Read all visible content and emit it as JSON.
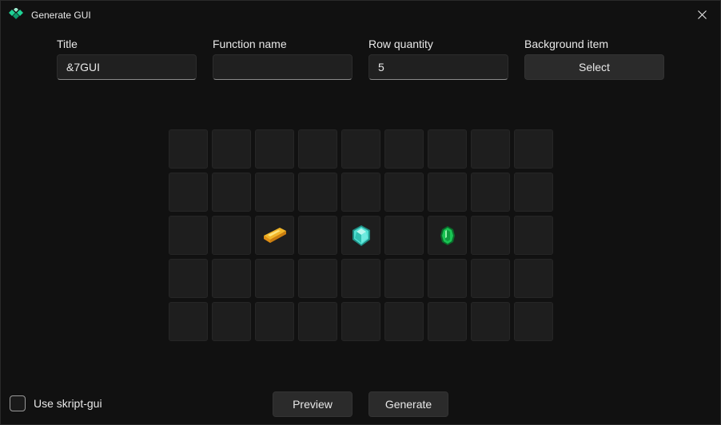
{
  "window": {
    "title": "Generate GUI",
    "app_icon": "diamond-cluster-icon",
    "accent_colors": [
      "#1fd396",
      "#0e9a6c"
    ]
  },
  "form": {
    "title_label": "Title",
    "title_value": "&7GUI",
    "function_label": "Function name",
    "function_value": "",
    "rows_label": "Row quantity",
    "rows_value": "5",
    "background_label": "Background item",
    "background_button": "Select"
  },
  "inventory": {
    "columns": 9,
    "rows": 5,
    "items": [
      {
        "row": 3,
        "col": 3,
        "icon": "gold-ingot-icon",
        "color": "#f1b528"
      },
      {
        "row": 3,
        "col": 5,
        "icon": "diamond-icon",
        "color": "#4fe0d2"
      },
      {
        "row": 3,
        "col": 7,
        "icon": "emerald-icon",
        "color": "#19c453"
      }
    ]
  },
  "footer": {
    "checkbox_label": "Use skript-gui",
    "checkbox_checked": false,
    "preview_label": "Preview",
    "generate_label": "Generate"
  }
}
